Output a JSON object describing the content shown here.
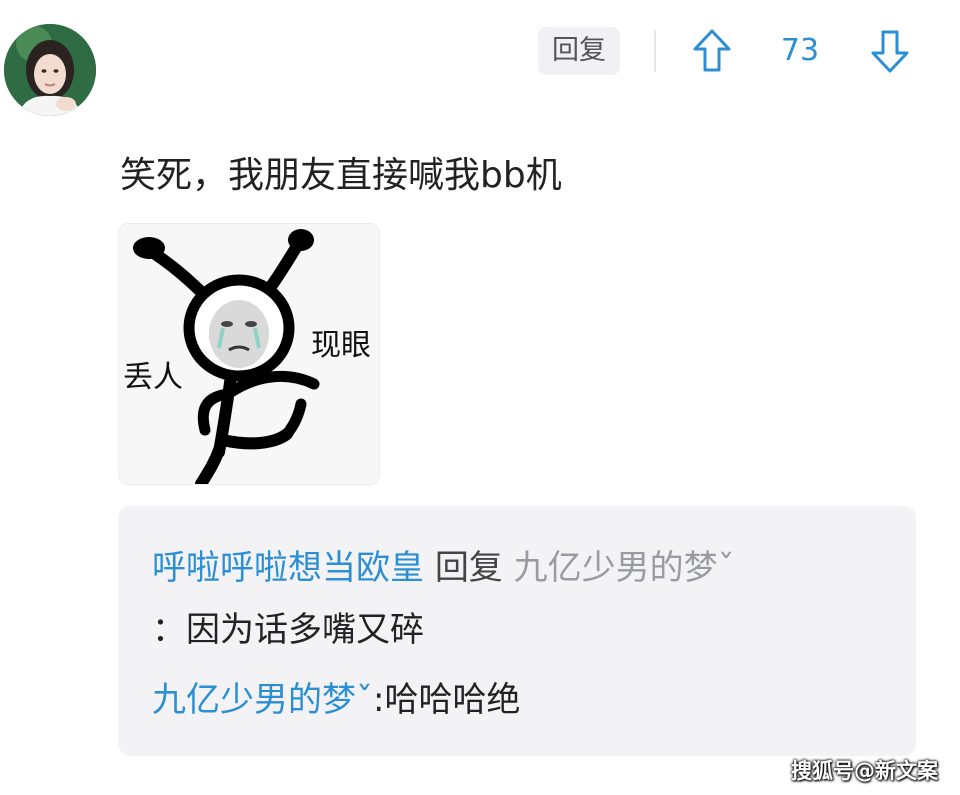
{
  "header": {
    "avatar_icon": "user-avatar",
    "reply_label": "回复",
    "vote_count": "73",
    "upvote_icon": "arrow-up-icon",
    "downvote_icon": "arrow-down-icon",
    "accent_color": "#2c8fd3"
  },
  "comment": {
    "text": "笑死，我朋友直接喊我bb机"
  },
  "meme": {
    "left_text": "丢人",
    "right_text": "现眼"
  },
  "thread": {
    "reply1_user": "呼啦呼啦想当欧皇",
    "reply1_word": "回复",
    "reply1_target": "九亿少男的梦ˇ",
    "reply1_text": "：因为话多嘴又碎",
    "reply2_user": "九亿少男的梦ˇ",
    "reply2_text": ":哈哈哈绝"
  },
  "watermark": {
    "text": "搜狐号@新文案"
  }
}
